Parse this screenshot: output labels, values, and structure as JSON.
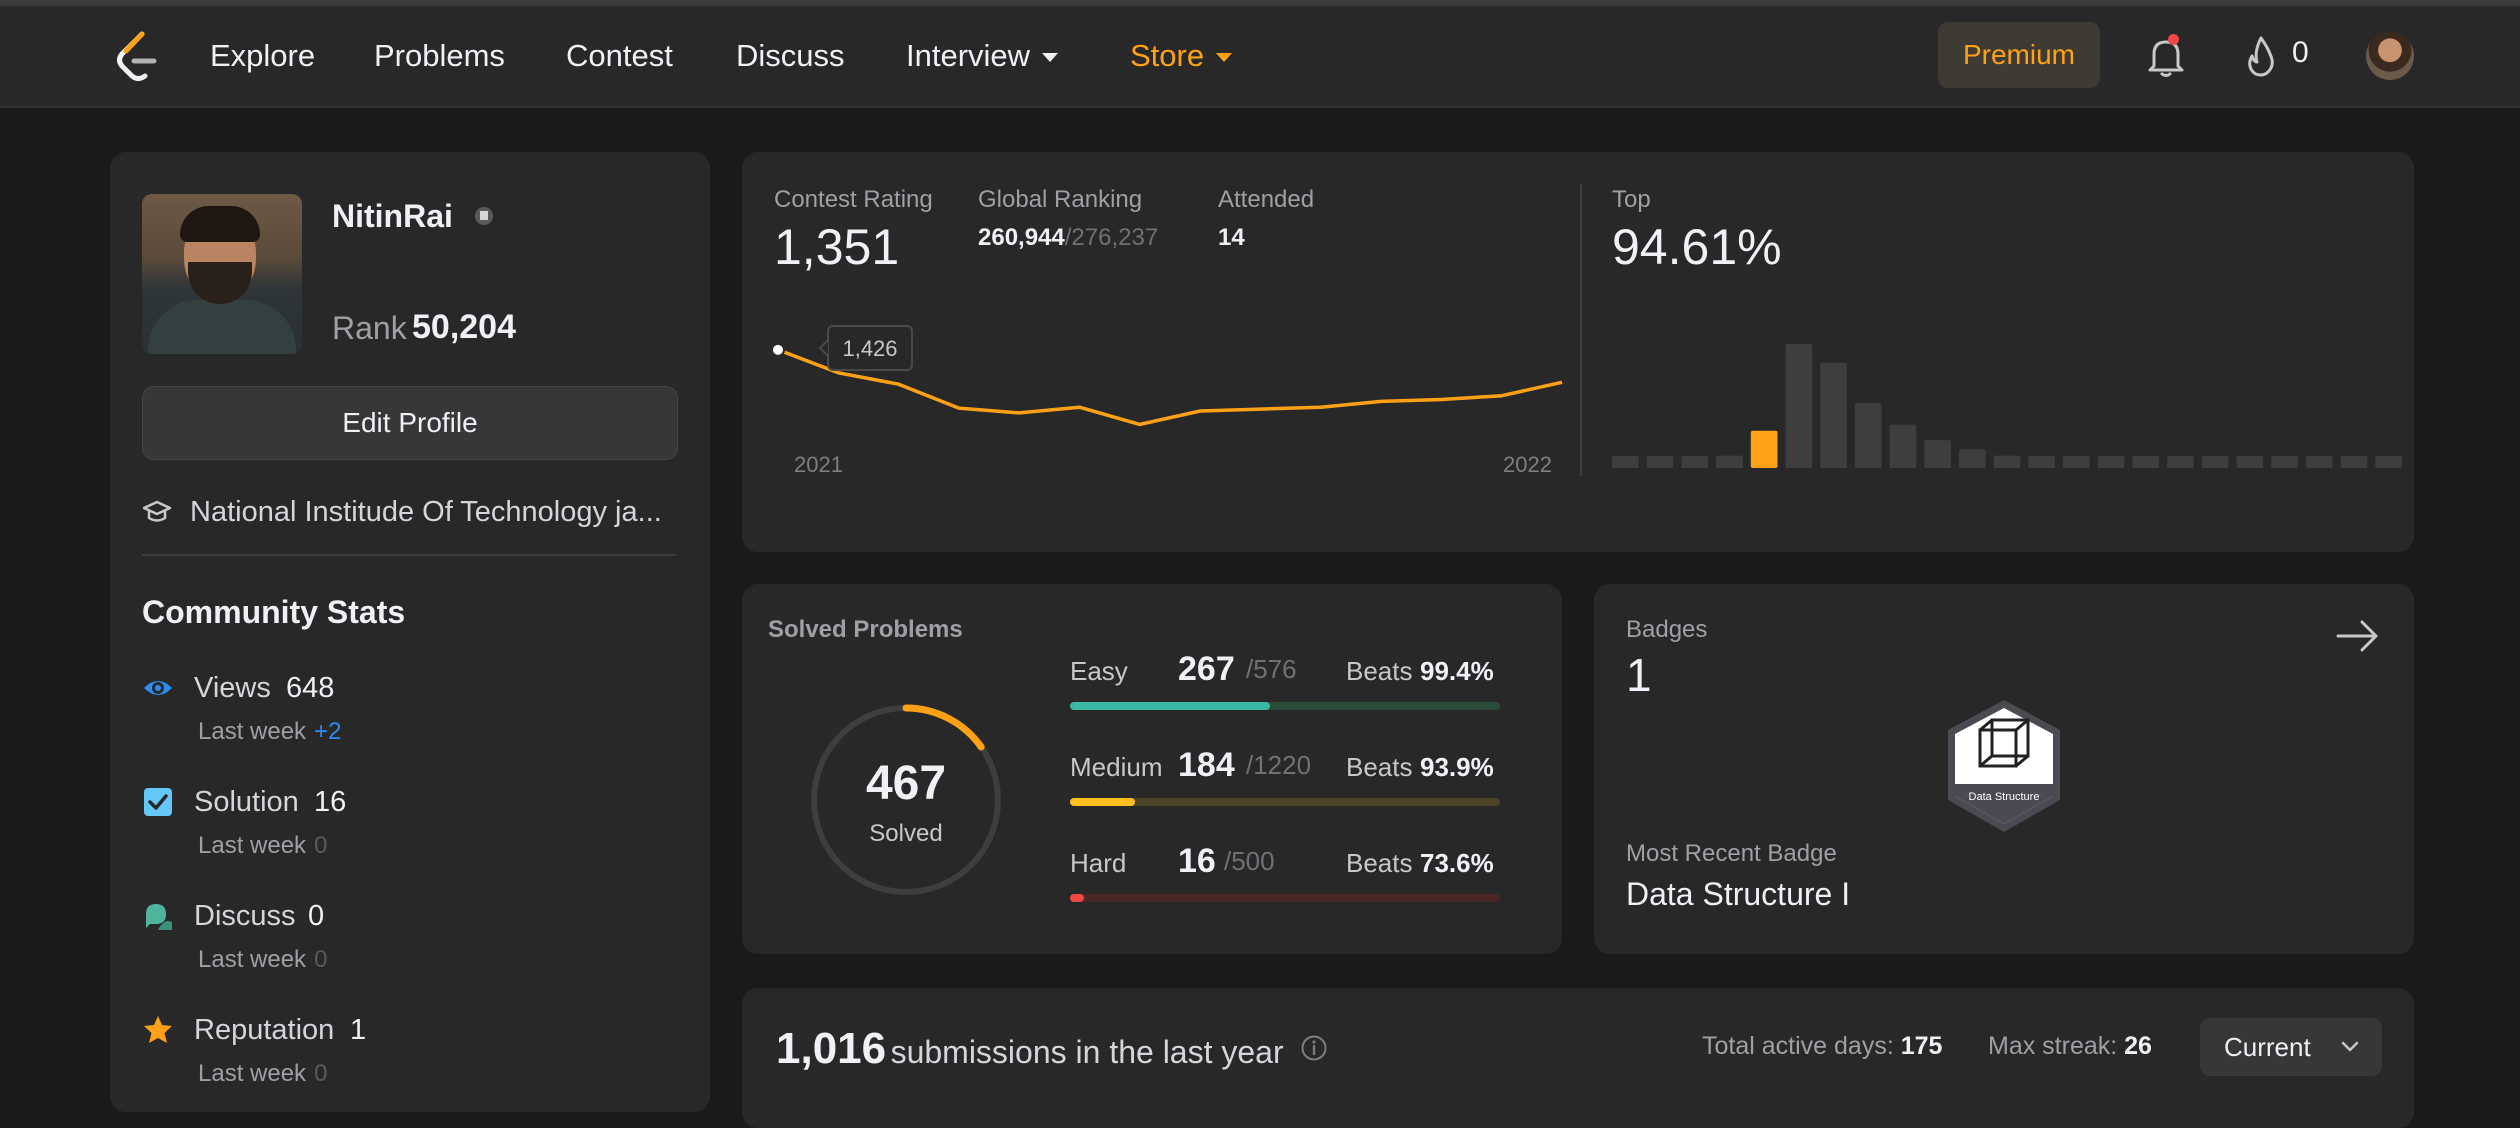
{
  "nav": {
    "items": [
      {
        "label": "Explore"
      },
      {
        "label": "Problems"
      },
      {
        "label": "Contest"
      },
      {
        "label": "Discuss"
      },
      {
        "label": "Interview"
      },
      {
        "label": "Store"
      }
    ],
    "premium_label": "Premium",
    "streak_count": "0",
    "accent": "#ffa116"
  },
  "profile": {
    "username": "NitinRai",
    "rank_label": "Rank",
    "rank_value": "50,204",
    "edit_label": "Edit Profile",
    "school": "National Institude Of Technology ja..."
  },
  "community": {
    "title": "Community Stats",
    "stats": [
      {
        "name": "Views",
        "value": "648",
        "sub": "Last week",
        "delta": "+2",
        "icon": "eye-icon",
        "color": "#2d8cf0"
      },
      {
        "name": "Solution",
        "value": "16",
        "sub": "Last week",
        "delta": "0",
        "icon": "check-icon",
        "color": "#64c7f5"
      },
      {
        "name": "Discuss",
        "value": "0",
        "sub": "Last week",
        "delta": "0",
        "icon": "chat-bubble-icon",
        "color": "#4fb49d"
      },
      {
        "name": "Reputation",
        "value": "1",
        "sub": "Last week",
        "delta": "0",
        "icon": "star-icon",
        "color": "#ffa116"
      }
    ]
  },
  "contest": {
    "rating_label": "Contest Rating",
    "rating_value": "1,351",
    "global_label": "Global Ranking",
    "global_value": "260,944",
    "global_total": "/276,237",
    "attended_label": "Attended",
    "attended_value": "14",
    "top_label": "Top",
    "top_value": "94.61%",
    "tooltip": "1,426",
    "year_start": "2021",
    "year_end": "2022"
  },
  "solved": {
    "title": "Solved Problems",
    "total": "467",
    "total_label": "Solved",
    "ring_fraction": 0.152,
    "difficulties": [
      {
        "name": "Easy",
        "solved": "267",
        "total": "/576",
        "beats_label": "Beats",
        "beats": "99.4%",
        "fraction": 0.464,
        "color": "#2cbb5d",
        "track": "#2b4a37",
        "fill": "#3bb8a4"
      },
      {
        "name": "Medium",
        "solved": "184",
        "total": "/1220",
        "beats_label": "Beats",
        "beats": "93.9%",
        "fraction": 0.151,
        "color": "#ffc01e",
        "track": "#4a4326",
        "fill": "#ffc01e"
      },
      {
        "name": "Hard",
        "solved": "16",
        "total": "/500",
        "beats_label": "Beats",
        "beats": "73.6%",
        "fraction": 0.032,
        "color": "#ef4743",
        "track": "#4a2626",
        "fill": "#ef4743"
      }
    ]
  },
  "badges": {
    "title": "Badges",
    "count": "1",
    "badge_text": "Data Structure",
    "recent_label": "Most Recent Badge",
    "recent_name": "Data Structure I"
  },
  "submissions": {
    "count": "1,016",
    "text": "submissions in the last year",
    "active_label": "Total active days:",
    "active_value": "175",
    "streak_label": "Max streak:",
    "streak_value": "26",
    "select_label": "Current"
  },
  "chart_data": [
    {
      "type": "line",
      "x": [
        "2021",
        "",
        "",
        "",
        "",
        "",
        "",
        "",
        "",
        "",
        "",
        "",
        "",
        "2022"
      ],
      "values": [
        1426,
        1402,
        1390,
        1365,
        1360,
        1366,
        1348,
        1362,
        1364,
        1366,
        1372,
        1374,
        1378,
        1392
      ],
      "xlabel": "",
      "ylabel": ""
    },
    {
      "type": "bar",
      "values": [
        2,
        2,
        2,
        4,
        12,
        40,
        34,
        21,
        14,
        9,
        6,
        4,
        3,
        3,
        3,
        3,
        3,
        3,
        3,
        3,
        3,
        3,
        3
      ],
      "highlight_index": 4,
      "colors": {
        "bar": "#3e3e3e",
        "highlight": "#ffa116"
      }
    }
  ]
}
